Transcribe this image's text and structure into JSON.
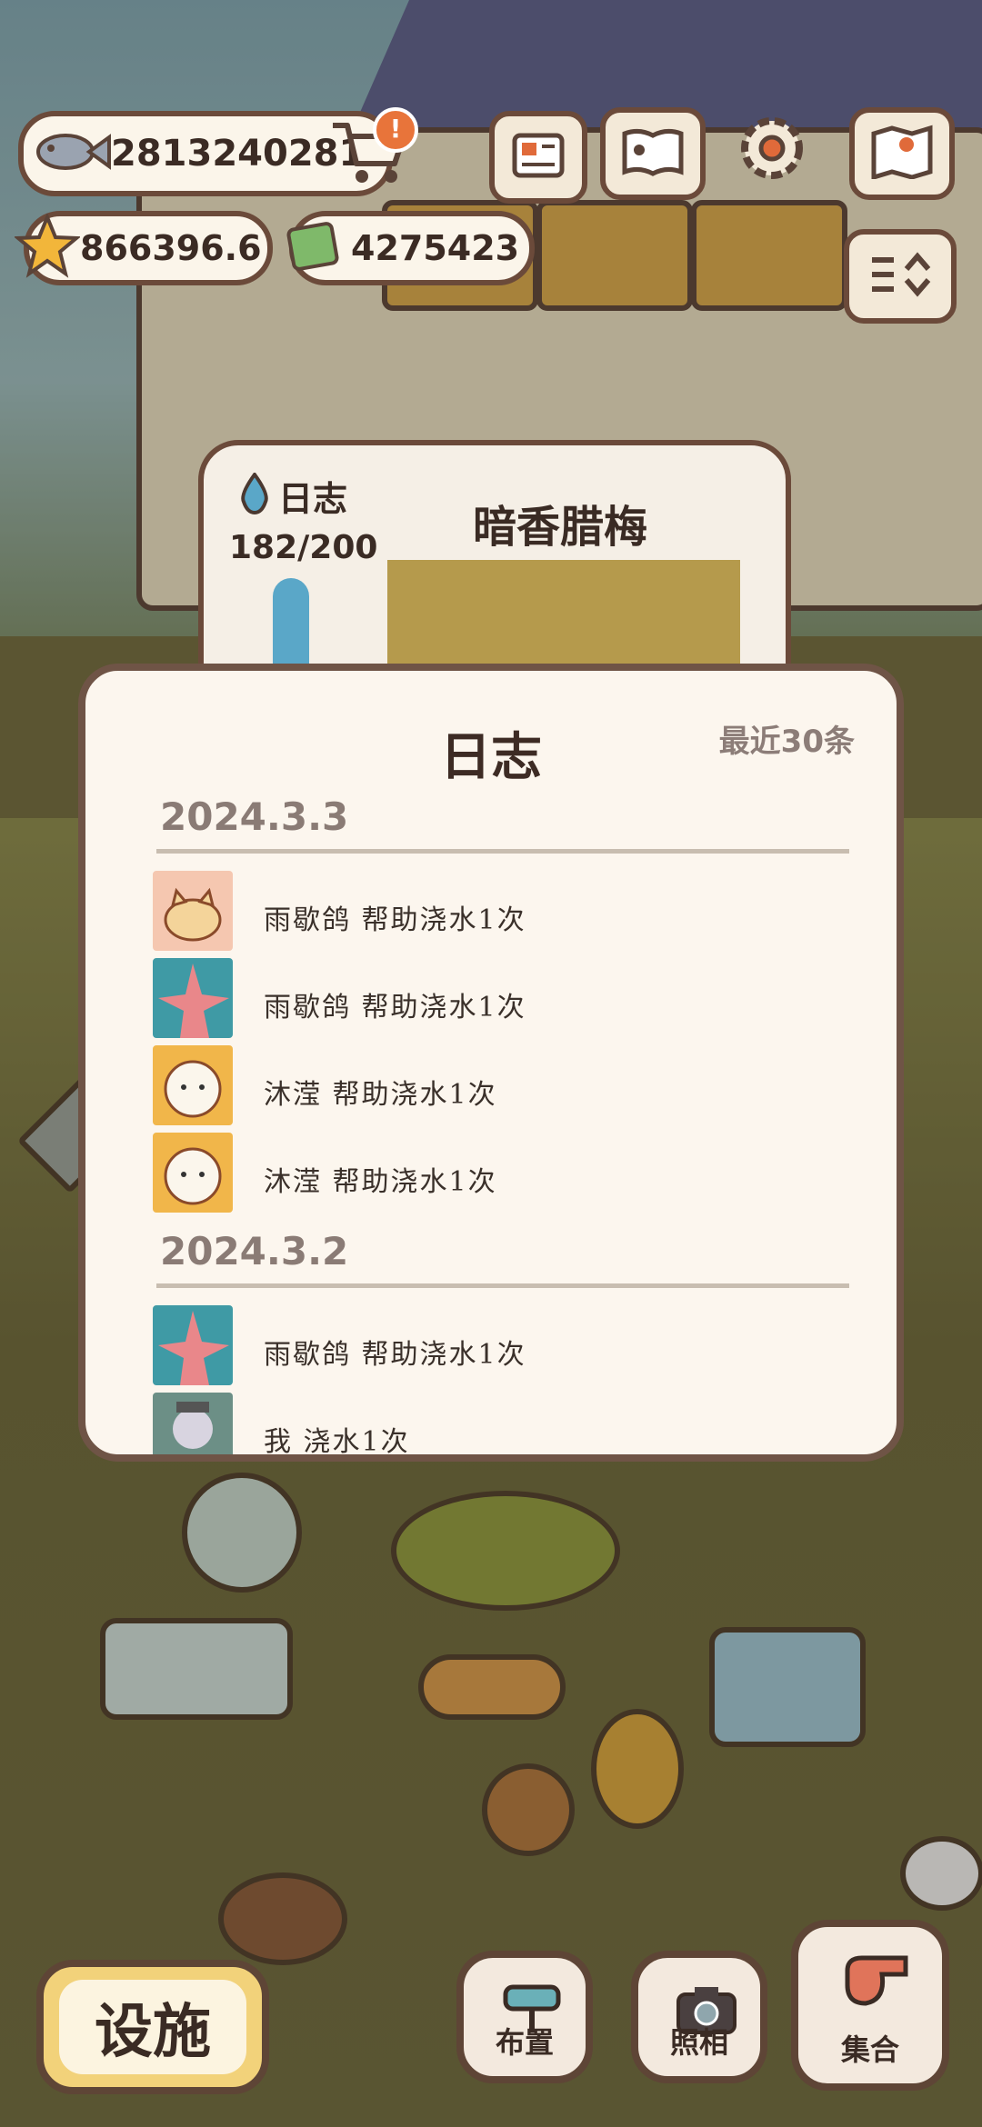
{
  "hud": {
    "fish_currency": "2813240281",
    "star_currency": "866396.6",
    "ticket_currency": "4275423",
    "shop_alert": "!"
  },
  "colors": {
    "dialog_bg": "#fcf6ee",
    "dialog_border": "#6f5446",
    "accent_orange": "#e8743a",
    "facility_yellow": "#f2d27a"
  },
  "background_panel": {
    "label": "日志",
    "count": "182/200",
    "title": "暗香腊梅"
  },
  "dialog": {
    "title": "日志",
    "recent_label": "最近30条",
    "groups": [
      {
        "date": "2024.3.3",
        "entries": [
          {
            "text": "雨歇鸽 帮助浇水1次",
            "avatar": "cat-avatar"
          },
          {
            "text": "雨歇鸽 帮助浇水1次",
            "avatar": "starfish-avatar"
          },
          {
            "text": "沐滢 帮助浇水1次",
            "avatar": "sheep-avatar"
          },
          {
            "text": "沐滢 帮助浇水1次",
            "avatar": "sheep-avatar"
          }
        ]
      },
      {
        "date": "2024.3.2",
        "entries": [
          {
            "text": "雨歇鸽 帮助浇水1次",
            "avatar": "starfish-avatar"
          },
          {
            "text": "我 浇水1次",
            "avatar": "character-avatar"
          }
        ]
      }
    ]
  },
  "bottom_bar": {
    "facility": "设施",
    "arrange": "布置",
    "camera": "照相",
    "gather": "集合"
  }
}
